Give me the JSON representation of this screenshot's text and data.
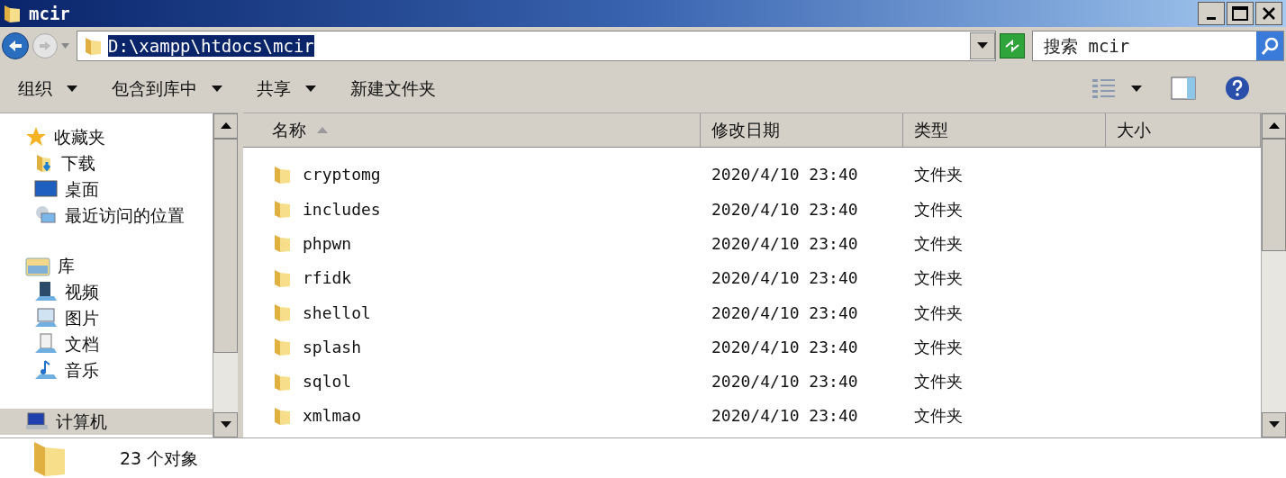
{
  "window": {
    "title": "mcir"
  },
  "address": {
    "path": "D:\\xampp\\htdocs\\mcir",
    "selected": true
  },
  "search": {
    "placeholder": "搜索 mcir"
  },
  "toolbar": [
    {
      "label": "组织",
      "dropdown": true
    },
    {
      "label": "包含到库中",
      "dropdown": true
    },
    {
      "label": "共享",
      "dropdown": true
    },
    {
      "label": "新建文件夹",
      "dropdown": false
    }
  ],
  "sidebar": {
    "groups": [
      {
        "label": "收藏夹",
        "kind": "favorites",
        "selected": false,
        "children": [
          {
            "label": "下载",
            "kind": "download",
            "selected": false
          },
          {
            "label": "桌面",
            "kind": "desktop",
            "selected": false
          },
          {
            "label": "最近访问的位置",
            "kind": "recent",
            "selected": false
          }
        ]
      },
      {
        "label": "库",
        "kind": "library",
        "selected": false,
        "children": [
          {
            "label": "视频",
            "kind": "video",
            "selected": false
          },
          {
            "label": "图片",
            "kind": "pictures",
            "selected": false
          },
          {
            "label": "文档",
            "kind": "documents",
            "selected": false
          },
          {
            "label": "音乐",
            "kind": "music",
            "selected": false
          }
        ]
      },
      {
        "label": "计算机",
        "kind": "computer",
        "selected": true
      }
    ]
  },
  "table": {
    "columns": [
      {
        "label": "名称",
        "sorted": true
      },
      {
        "label": "修改日期",
        "sorted": false
      },
      {
        "label": "类型",
        "sorted": false
      },
      {
        "label": "大小",
        "sorted": false
      }
    ],
    "rows": [
      {
        "name": "cryptomg",
        "date": "2020/4/10 23:40",
        "type": "文件夹"
      },
      {
        "name": "includes",
        "date": "2020/4/10 23:40",
        "type": "文件夹"
      },
      {
        "name": "phpwn",
        "date": "2020/4/10 23:40",
        "type": "文件夹"
      },
      {
        "name": "rfidk",
        "date": "2020/4/10 23:40",
        "type": "文件夹"
      },
      {
        "name": "shellol",
        "date": "2020/4/10 23:40",
        "type": "文件夹"
      },
      {
        "name": "splash",
        "date": "2020/4/10 23:40",
        "type": "文件夹"
      },
      {
        "name": "sqlol",
        "date": "2020/4/10 23:40",
        "type": "文件夹"
      },
      {
        "name": "xmlmao",
        "date": "2020/4/10 23:40",
        "type": "文件夹"
      }
    ]
  },
  "status_bar": {
    "count": "23 个对象"
  }
}
